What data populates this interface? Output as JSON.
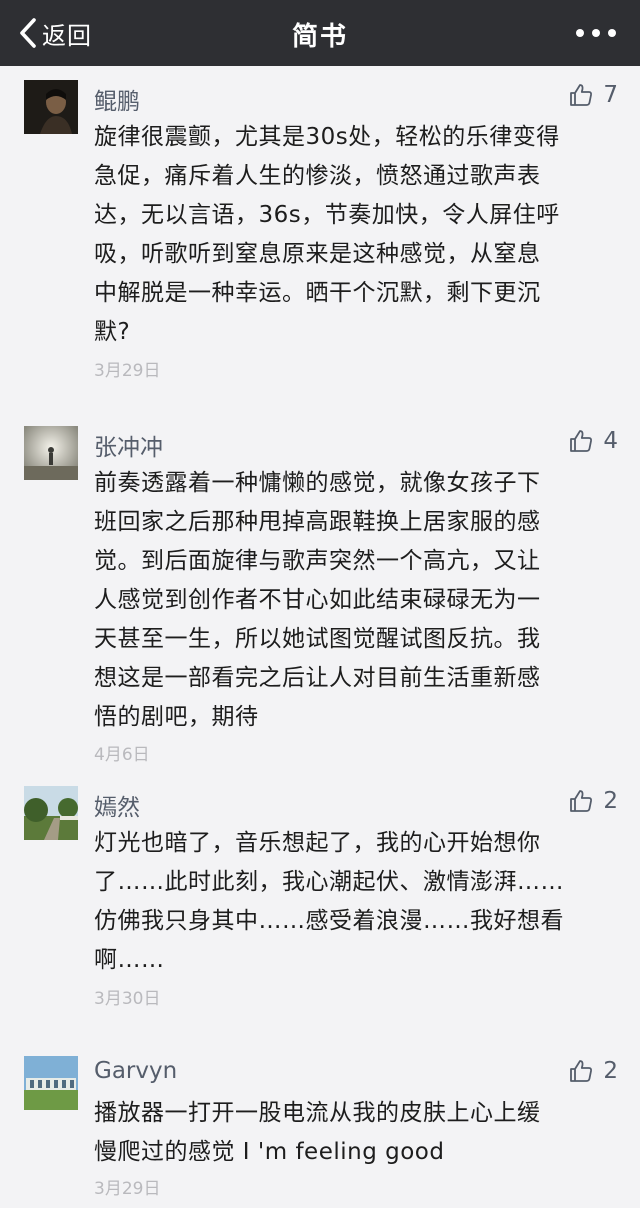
{
  "nav": {
    "back_label": "返回",
    "title": "简书",
    "more_icon": "more-dots-icon",
    "back_icon": "chevron-left-icon"
  },
  "comments": [
    {
      "username": "鲲鹏",
      "likes": "7",
      "lines": [
        "旋律很震颤，尤其是30s处，轻松的乐律变得",
        "急促，痛斥着人生的惨淡，愤怒通过歌声表",
        "达，无以言语，36s，节奏加快，令人屏住呼",
        "吸，听歌听到窒息原来是这种感觉，从窒息",
        "中解脱是一种幸运。晒干个沉默，剩下更沉",
        "默?"
      ],
      "date": "3月29日"
    },
    {
      "username": "张冲冲",
      "likes": "4",
      "lines": [
        "前奏透露着一种慵懒的感觉，就像女孩子下",
        "班回家之后那种甩掉高跟鞋换上居家服的感",
        "觉。到后面旋律与歌声突然一个高亢，又让",
        "人感觉到创作者不甘心如此结束碌碌无为一",
        "天甚至一生，所以她试图觉醒试图反抗。我",
        "想这是一部看完之后让人对目前生活重新感",
        "悟的剧吧，期待"
      ],
      "date": "4月6日"
    },
    {
      "username": "嫣然",
      "likes": "2",
      "lines": [
        "灯光也暗了，音乐想起了，我的心开始想你",
        "了……此时此刻，我心潮起伏、激情澎湃……",
        "仿佛我只身其中……感受着浪漫……我好想看",
        "啊……"
      ],
      "date": "3月30日"
    },
    {
      "username": "Garvyn",
      "likes": "2",
      "lines": [
        "播放器一打开一股电流从我的皮肤上心上缓",
        "慢爬过的感觉  I 'm feeling good"
      ],
      "date": "3月29日"
    }
  ],
  "colors": {
    "navbar_bg": "#2e2f33",
    "page_bg": "#f3f3f5",
    "username": "#555d6b",
    "date": "#b9b9bd"
  }
}
